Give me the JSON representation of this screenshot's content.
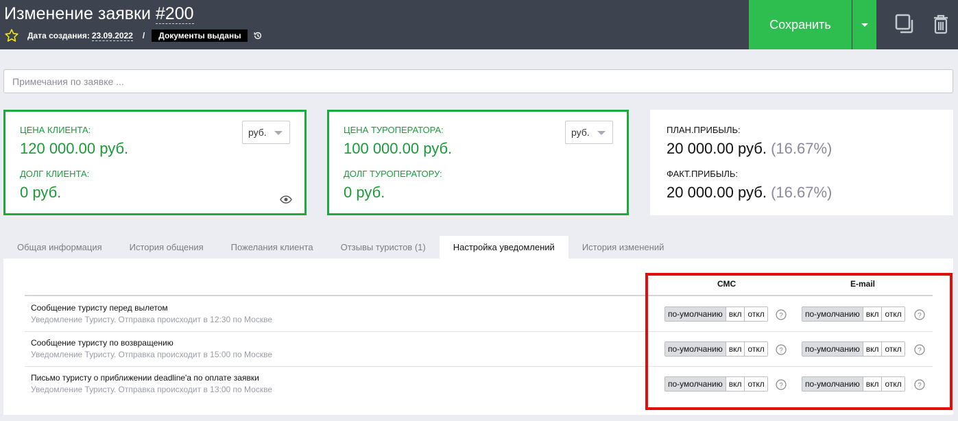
{
  "header": {
    "title_prefix": "Изменение заявки ",
    "title_number": "#200",
    "date_label": "Дата создания:",
    "date_value": "23.09.2022",
    "separator": "/",
    "status": "Документы выданы",
    "save_label": "Сохранить"
  },
  "notes": {
    "placeholder": "Примечания по заявке ..."
  },
  "client_card": {
    "price_label": "ЦЕНА КЛИЕНТА:",
    "price_value": "120 000.00 руб.",
    "debt_label": "ДОЛГ КЛИЕНТА:",
    "debt_value": "0 руб.",
    "currency": "руб."
  },
  "operator_card": {
    "price_label": "ЦЕНА ТУРОПЕРАТОРА:",
    "price_value": "100 000.00 руб.",
    "debt_label": "ДОЛГ ТУРОПЕРАТОРУ:",
    "debt_value": "0 руб.",
    "currency": "руб."
  },
  "profit_card": {
    "plan_label": "ПЛАН.ПРИБЫЛЬ:",
    "plan_value": "20 000.00 руб.",
    "plan_pct": "(16.67%)",
    "fact_label": "ФАКТ.ПРИБЫЛЬ:",
    "fact_value": "20 000.00 руб.",
    "fact_pct": "(16.67%)"
  },
  "tabs": [
    {
      "label": "Общая информация"
    },
    {
      "label": "История общения"
    },
    {
      "label": "Пожелания клиента"
    },
    {
      "label": "Отзывы туристов (1)"
    },
    {
      "label": "Настройка уведомлений"
    },
    {
      "label": "История изменений"
    }
  ],
  "active_tab": "Настройка уведомлений",
  "notifications": {
    "col_sms": "СМС",
    "col_email": "E-mail",
    "option_default": "по-умолчанию",
    "option_on": "вкл",
    "option_off": "откл",
    "rows": [
      {
        "title": "Сообщение туристу перед вылетом",
        "subtitle": "Уведомление Туристу. Отправка происходит в 12:30 по Москве"
      },
      {
        "title": "Сообщение туристу по возвращению",
        "subtitle": "Уведомление Туристу. Отправка происходит в 15:00 по Москве"
      },
      {
        "title": "Письмо туристу о приближении deadline'а по оплате заявки",
        "subtitle": "Уведомление Туристу. Отправка происходит в 13:00 по Москве"
      }
    ]
  },
  "colors": {
    "header_bg": "#3d4450",
    "save_green": "#2dbe4f",
    "card_green": "#1fa83e",
    "highlight_red": "#e50c0c"
  }
}
